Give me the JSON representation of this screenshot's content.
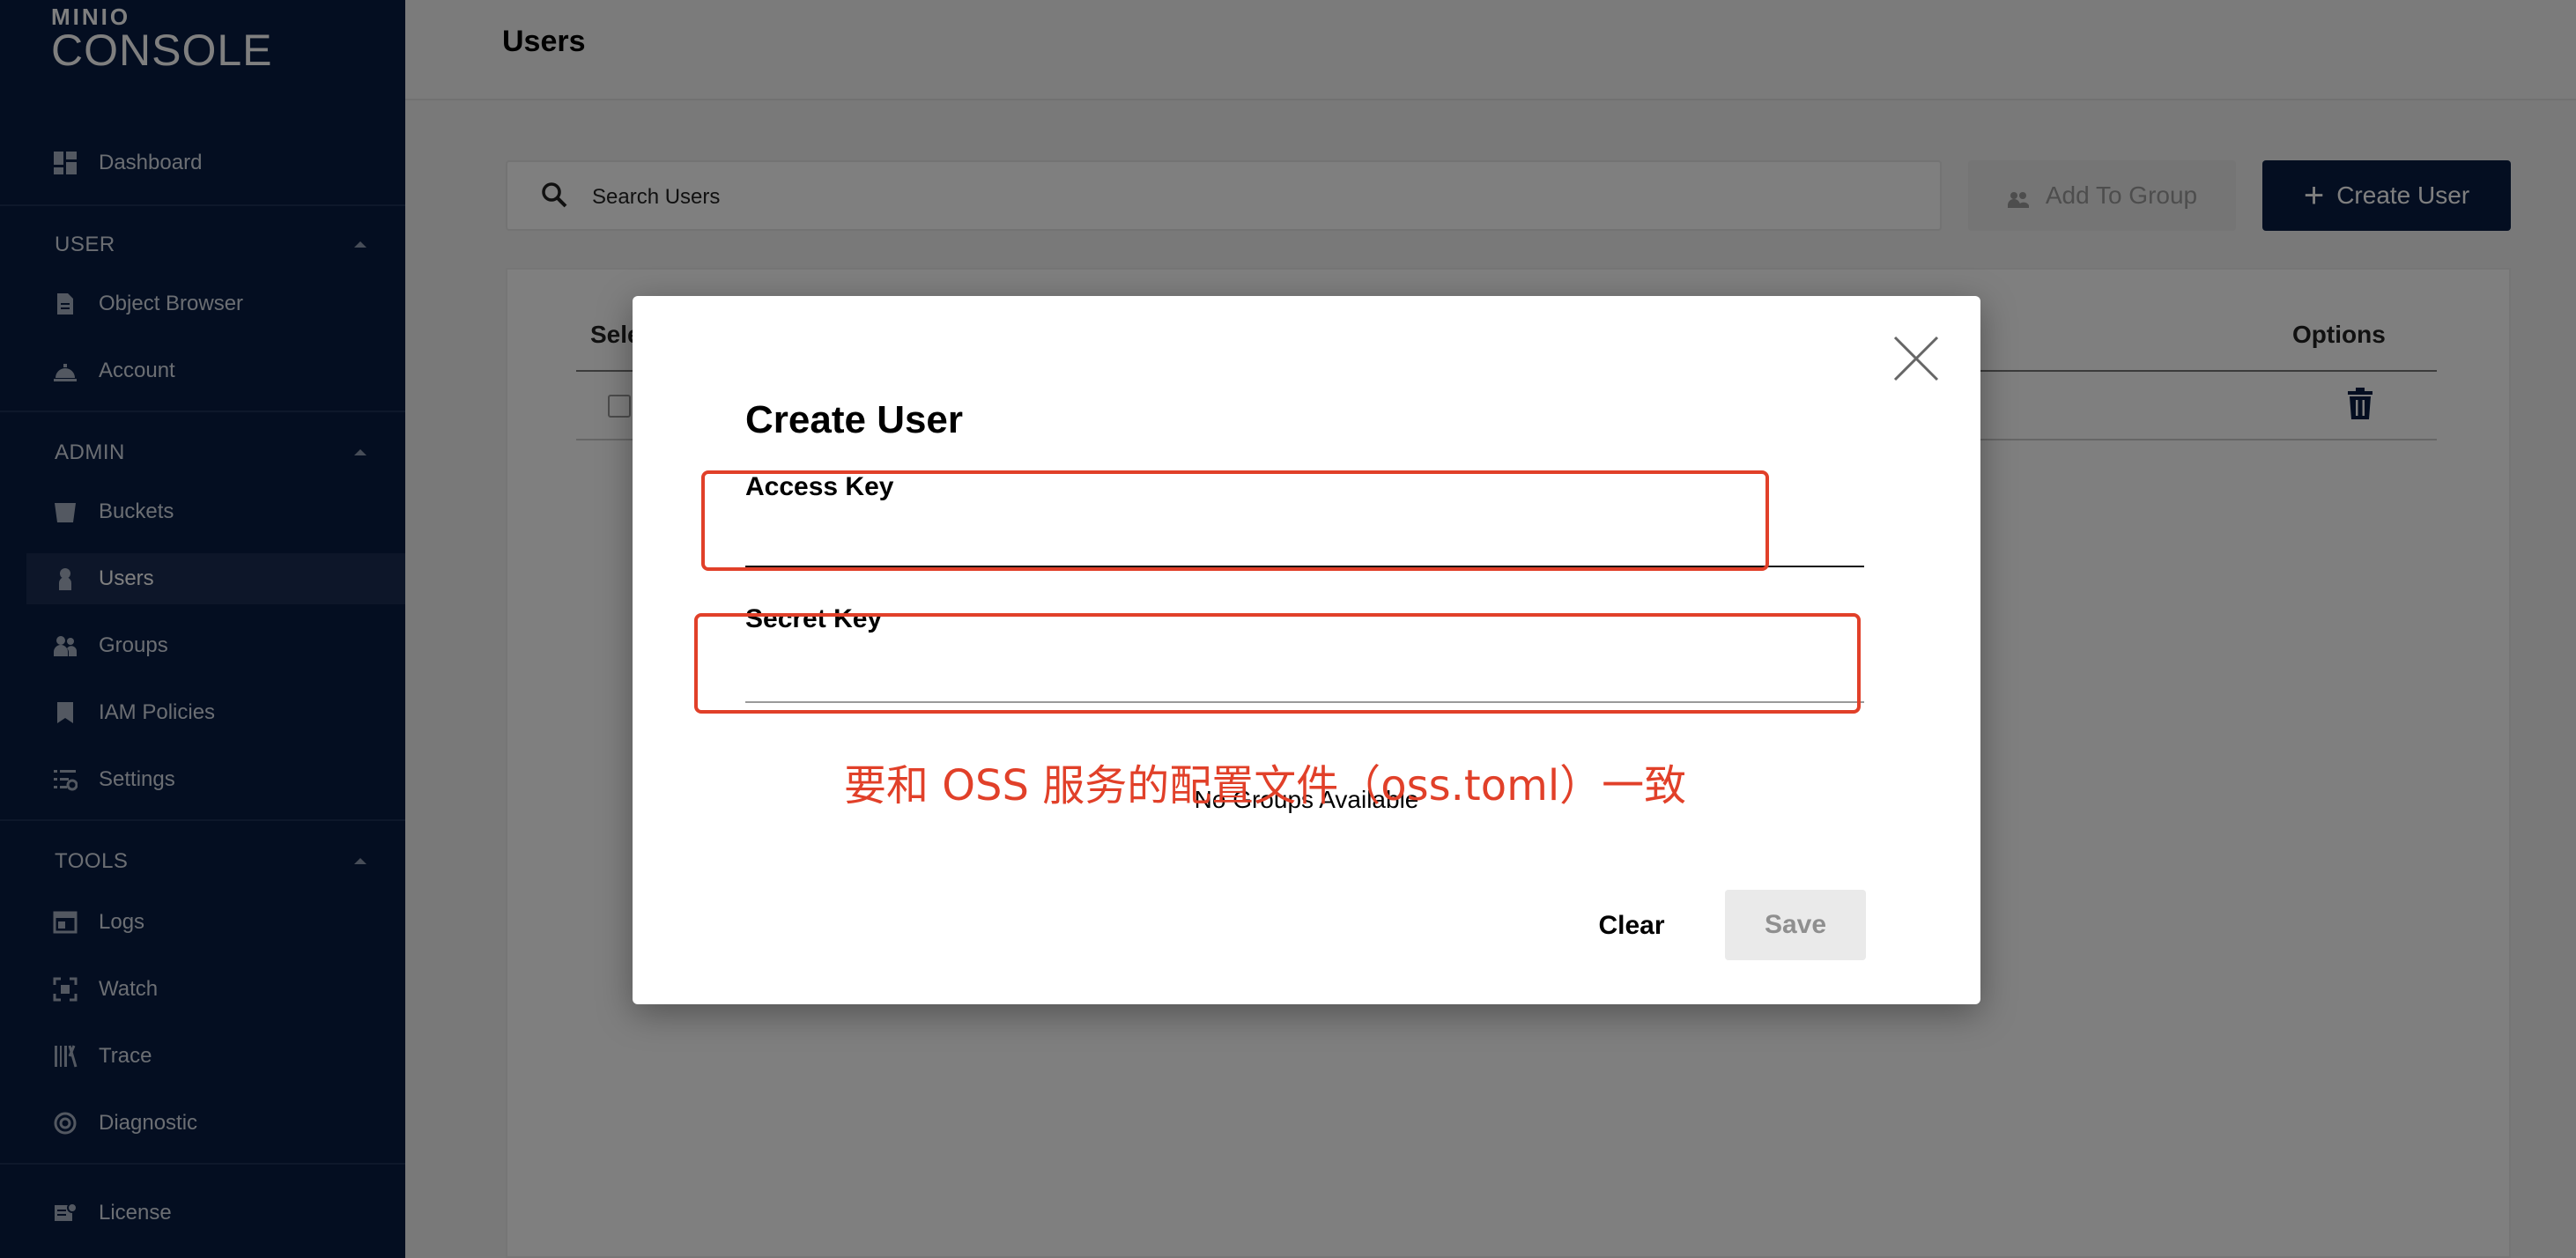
{
  "logo": {
    "top": "MINIO",
    "bottom": "CONSOLE"
  },
  "sidebar": {
    "dashboard": "Dashboard",
    "sections": [
      {
        "label": "USER",
        "items": [
          "Object Browser",
          "Account"
        ]
      },
      {
        "label": "ADMIN",
        "items": [
          "Buckets",
          "Users",
          "Groups",
          "IAM Policies",
          "Settings"
        ]
      },
      {
        "label": "TOOLS",
        "items": [
          "Logs",
          "Watch",
          "Trace",
          "Diagnostic"
        ]
      }
    ],
    "license": "License",
    "active_item": "Users"
  },
  "header": {
    "title": "Users"
  },
  "toolbar": {
    "search_placeholder": "Search Users",
    "add_to_group": "Add To Group",
    "create_user": "Create User"
  },
  "table": {
    "col_select": "Sele",
    "col_options": "Options"
  },
  "modal": {
    "title": "Create User",
    "access_key_label": "Access Key",
    "secret_key_label": "Secret Key",
    "no_groups": "No Groups Available",
    "clear_label": "Clear",
    "save_label": "Save"
  },
  "annotation": {
    "text": "要和 OSS 服务的配置文件（oss.toml）一致",
    "color": "#e14029"
  },
  "colors": {
    "sidebar_bg": "#081c42",
    "primary": "#081c42"
  }
}
